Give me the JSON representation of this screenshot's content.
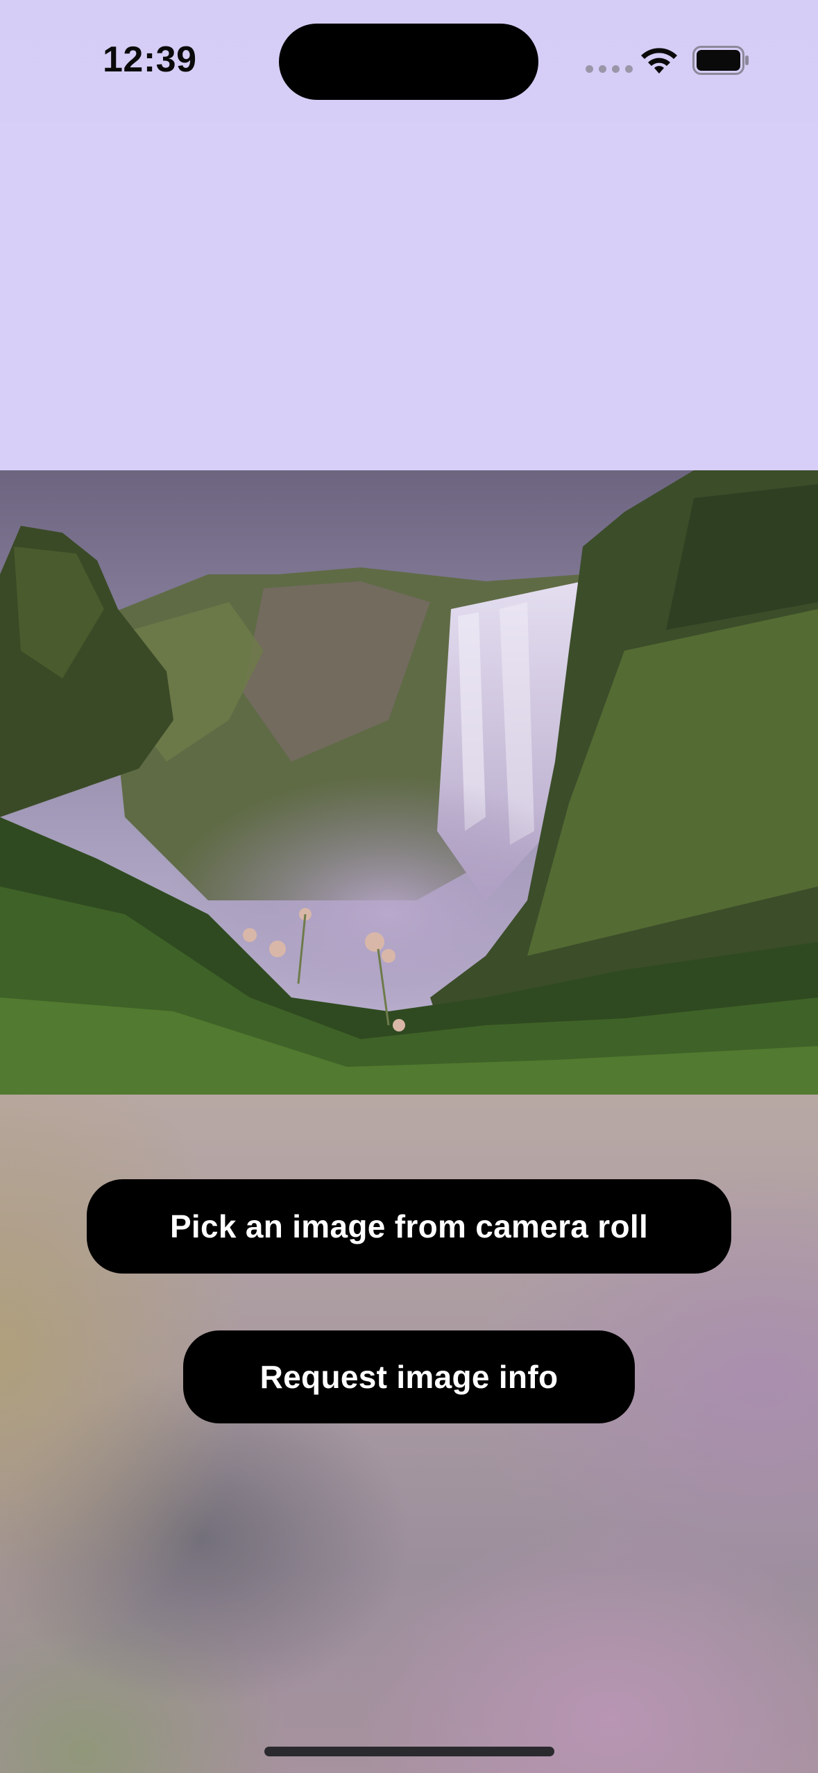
{
  "status_bar": {
    "time": "12:39",
    "icons": [
      "signal-dots-icon",
      "wifi-icon",
      "battery-icon"
    ]
  },
  "image": {
    "description_icon": "waterfall-photo"
  },
  "buttons": {
    "pick_image": "Pick an image from camera roll",
    "request_info": "Request image info"
  },
  "colors": {
    "background_top": "#d8cff9",
    "button_bg": "#000000",
    "button_text": "#ffffff"
  }
}
